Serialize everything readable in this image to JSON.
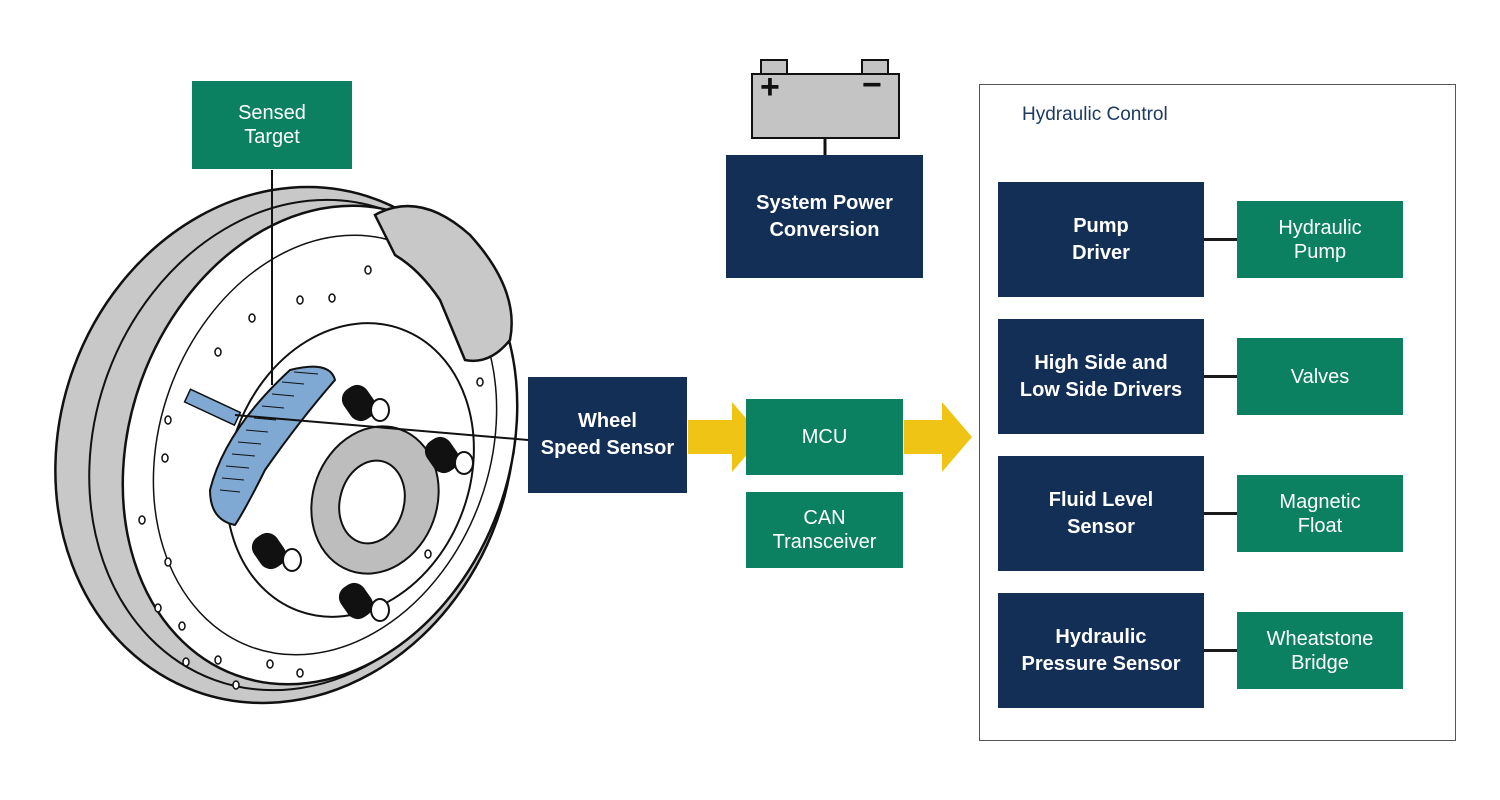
{
  "diagram": {
    "sensed_target": {
      "label": "Sensed\nTarget"
    },
    "wheel_speed_sensor": {
      "label": "Wheel\nSpeed Sensor"
    },
    "battery": {
      "positive_symbol": "+",
      "negative_symbol": "−"
    },
    "system_power_conversion": {
      "label": "System Power\nConversion"
    },
    "mcu": {
      "label": "MCU"
    },
    "can_transceiver": {
      "label": "CAN\nTransceiver"
    },
    "hydraulic_control": {
      "title": "Hydraulic Control",
      "rows": [
        {
          "driver": "Pump\nDriver",
          "component": "Hydraulic\nPump"
        },
        {
          "driver": "High Side and\nLow Side Drivers",
          "component": "Valves"
        },
        {
          "driver": "Fluid Level\nSensor",
          "component": "Magnetic\nFloat"
        },
        {
          "driver": "Hydraulic\nPressure Sensor",
          "component": "Wheatstone\nBridge"
        }
      ]
    },
    "colors": {
      "navy": "#132f55",
      "green": "#0b8162",
      "arrow_yellow": "#f0c414",
      "battery_gray": "#c4c4c4",
      "target_blue": "#7fa9d3"
    }
  }
}
